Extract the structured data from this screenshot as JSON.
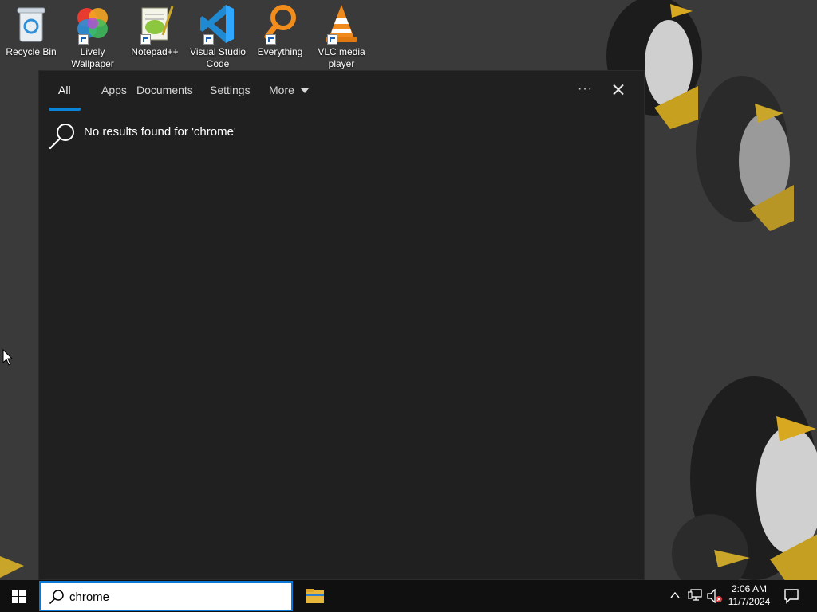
{
  "desktop": {
    "icons": [
      {
        "label": "Recycle Bin"
      },
      {
        "label": "Lively Wallpaper"
      },
      {
        "label": "Notepad++"
      },
      {
        "label": "Visual Studio Code"
      },
      {
        "label": "Everything"
      },
      {
        "label": "VLC media player"
      }
    ]
  },
  "search_panel": {
    "tabs": [
      {
        "label": "All"
      },
      {
        "label": "Apps"
      },
      {
        "label": "Documents"
      },
      {
        "label": "Settings"
      },
      {
        "label": "More"
      }
    ],
    "more_options": "···",
    "no_results_message": "No results found for 'chrome'"
  },
  "taskbar": {
    "search_value": "chrome",
    "clock_time": "2:06 AM",
    "clock_date": "11/7/2024"
  },
  "colors": {
    "accent": "#0a84d8",
    "panel_bg": "#202020",
    "taskbar_bg": "#101010"
  }
}
